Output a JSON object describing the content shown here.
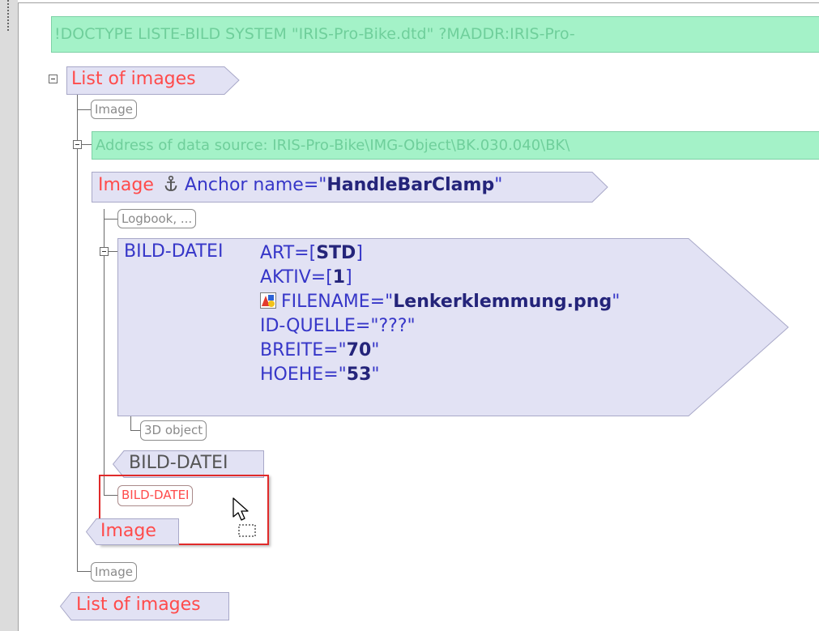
{
  "processing_instruction": "!DOCTYPE LISTE-BILD SYSTEM \"IRIS-Pro-Bike.dtd\" ?MADDR:IRIS-Pro-",
  "address_comment": "Address of data source: IRIS-Pro-Bike\\IMG-Object\\BK.030.040\\BK\\",
  "list_of_images_open": "List of images",
  "list_of_images_close": "List of images",
  "image_placeholder_1": "Image",
  "image_placeholder_2": "Image",
  "image_open": {
    "label": "Image",
    "anchor_attr": "Anchor name=",
    "anchor_value": "HandleBarClamp"
  },
  "logbook_placeholder": "Logbook, ...",
  "bild_datei": {
    "label": "BILD-DATEI",
    "art": {
      "name": "ART=",
      "value": "STD"
    },
    "aktiv": {
      "name": "AKTIV=",
      "value": "1"
    },
    "filename": {
      "name": "FILENAME=",
      "value": "Lenkerklemmung.png"
    },
    "id_quelle": {
      "name": "ID-QUELLE=",
      "value": "???"
    },
    "breite": {
      "name": "BREITE=",
      "value": "70"
    },
    "hoehe": {
      "name": "HOEHE=",
      "value": "53"
    }
  },
  "object_3d_placeholder": "3D object",
  "bild_datei_close": "BILD-DATEI",
  "bild_datei_new": "BILD-DATEI",
  "image_close": "Image",
  "icons": {
    "anchor": "anchor-icon",
    "file_image": "image-file-icon",
    "cursor": "drag-cursor-icon"
  },
  "colors": {
    "pi_background": "#a4f2c8",
    "tag_background": "#e2e2f4",
    "tag_label": "#ff4b4b",
    "attribute": "#3636c8",
    "selection": "#e02a2a"
  }
}
